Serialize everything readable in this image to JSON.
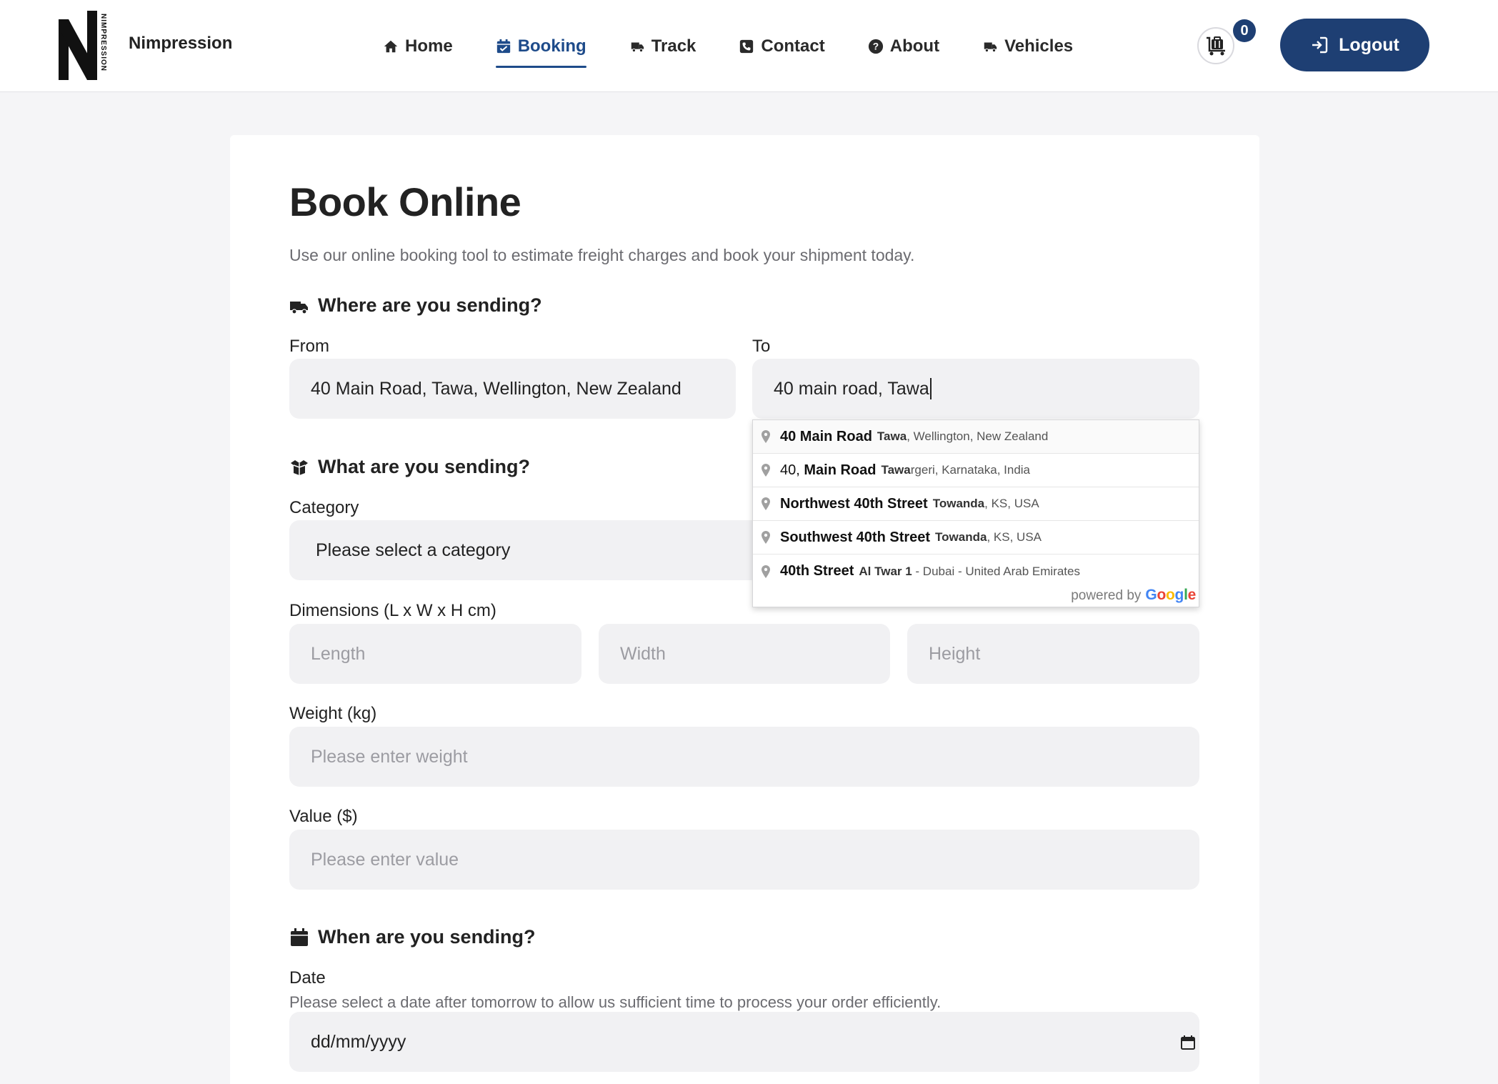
{
  "brand": {
    "name": "Nimpression",
    "logo_text": "NIMPRESSION"
  },
  "nav": {
    "items": [
      {
        "label": "Home",
        "icon": "home-icon"
      },
      {
        "label": "Booking",
        "icon": "calendar-check-icon",
        "active": true
      },
      {
        "label": "Track",
        "icon": "truck-fast-icon"
      },
      {
        "label": "Contact",
        "icon": "phone-icon"
      },
      {
        "label": "About",
        "icon": "question-circle-icon"
      },
      {
        "label": "Vehicles",
        "icon": "truck-fast-icon"
      }
    ]
  },
  "cart": {
    "icon": "luggage-cart-icon",
    "count": "0"
  },
  "logout": {
    "label": "Logout",
    "icon": "sign-in-icon"
  },
  "page": {
    "title": "Book Online",
    "subtitle": "Use our online booking tool to estimate freight charges and book your shipment today."
  },
  "where": {
    "heading": "Where are you sending?",
    "icon": "truck-icon",
    "from_label": "From",
    "from_value": "40 Main Road, Tawa, Wellington, New Zealand",
    "to_label": "To",
    "to_value": "40 main road, Tawa"
  },
  "autocomplete": {
    "items": [
      {
        "main": "40 Main Road",
        "secondary_bold": "Tawa",
        "secondary_rest": ", Wellington, New Zealand"
      },
      {
        "main_prefix": "40, ",
        "main": "Main Road",
        "secondary_bold": "Tawa",
        "secondary_rest": "rgeri, Karnataka, India"
      },
      {
        "main": "Northwest 40th Street",
        "secondary_bold": "Towanda",
        "secondary_rest": ", KS, USA"
      },
      {
        "main": "Southwest 40th Street",
        "secondary_bold": "Towanda",
        "secondary_rest": ", KS, USA"
      },
      {
        "main": "40th Street",
        "secondary_bold": "Al Twar 1",
        "secondary_rest": " - Dubai - United Arab Emirates"
      }
    ],
    "powered_by": "powered by",
    "provider": "Google"
  },
  "what": {
    "heading": "What are you sending?",
    "icon": "box-open-icon",
    "category_label": "Category",
    "category_value": "Please select a category",
    "dimensions_label": "Dimensions (L x W x H cm)",
    "length_placeholder": "Length",
    "width_placeholder": "Width",
    "height_placeholder": "Height",
    "weight_label": "Weight (kg)",
    "weight_placeholder": "Please enter weight",
    "value_label": "Value ($)",
    "value_placeholder": "Please enter value"
  },
  "when": {
    "heading": "When are you sending?",
    "icon": "calendar-icon",
    "date_label": "Date",
    "date_hint": "Please select a date after tomorrow to allow us sufficient time to process your order efficiently.",
    "date_placeholder": "dd/mm/yyyy"
  },
  "colors": {
    "primary": "#1e3f73",
    "active_nav": "#1e4b8a",
    "field_bg": "#f1f1f3",
    "page_bg": "#f5f5f7"
  }
}
